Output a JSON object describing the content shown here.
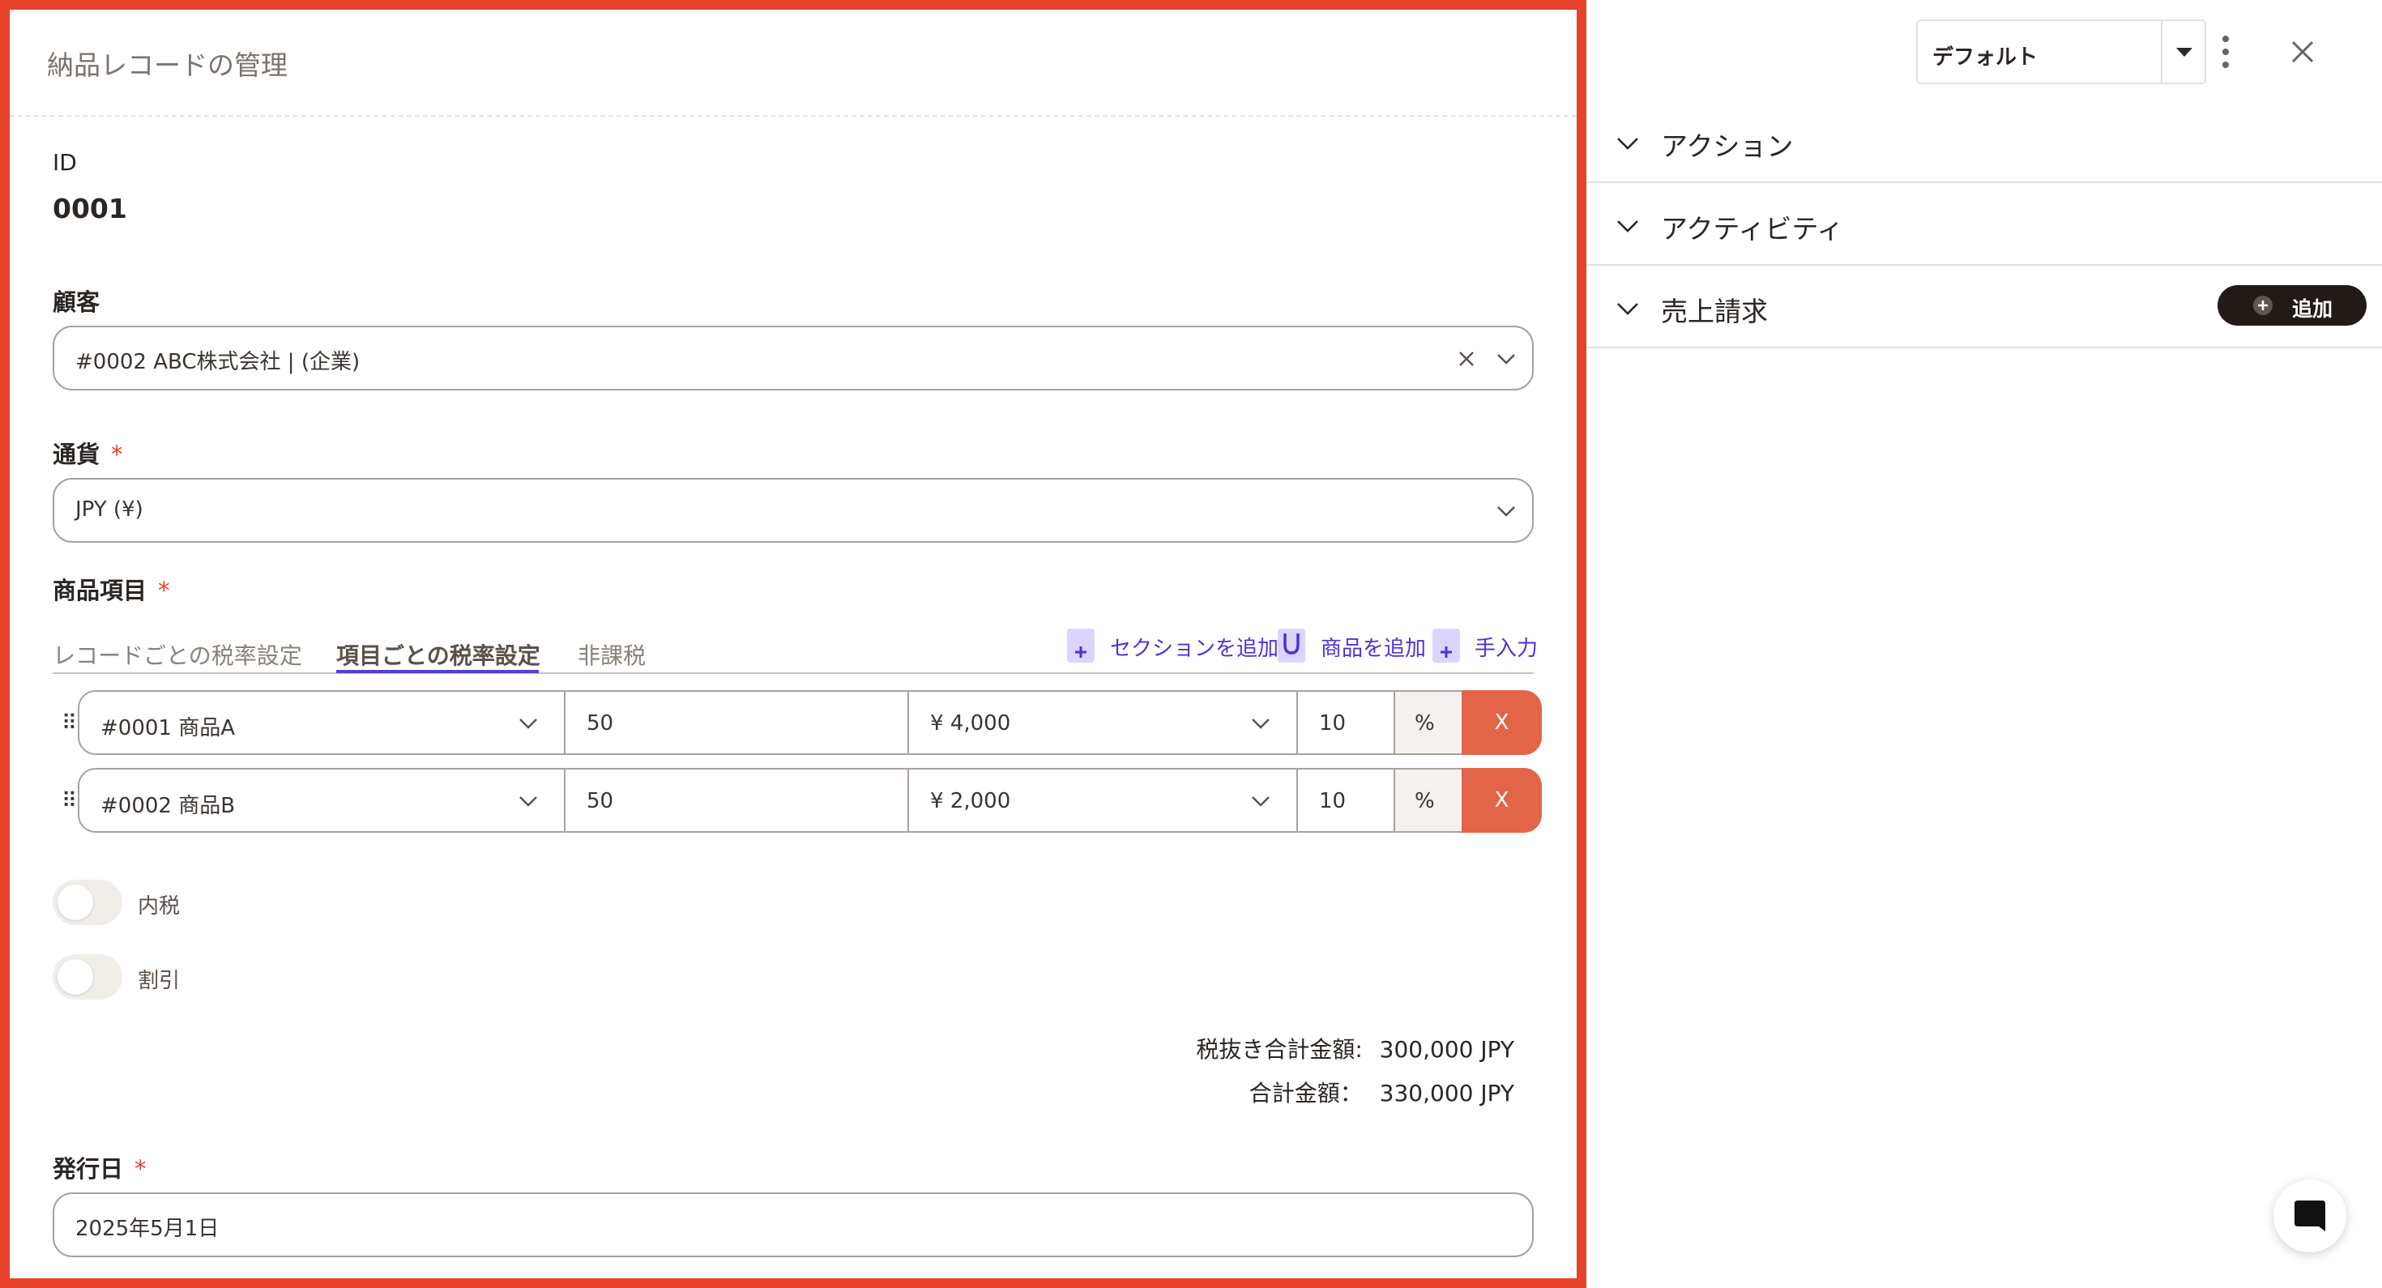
{
  "header": {
    "title": "納品レコードの管理"
  },
  "record": {
    "id_label": "ID",
    "id_value": "0001"
  },
  "customer": {
    "label": "顧客",
    "value": "#0002 ABC株式会社 | (企業)"
  },
  "currency": {
    "label": "通貨",
    "required_mark": "*",
    "value": "JPY (¥)"
  },
  "items": {
    "label": "商品項目",
    "required_mark": "*",
    "tabs": [
      {
        "label": "レコードごとの税率設定",
        "active": false
      },
      {
        "label": "項目ごとの税率設定",
        "active": true
      },
      {
        "label": "非課税",
        "active": false
      }
    ],
    "actions": {
      "add_section": "セクションを追加",
      "add_product": "商品を追加",
      "manual_entry": "手入力"
    },
    "rows": [
      {
        "handle": "⠿",
        "product": "#0001 商品A",
        "quantity": "50",
        "price": "¥ 4,000",
        "tax": "10",
        "unit": "%",
        "delete": "X"
      },
      {
        "handle": "⠿",
        "product": "#0002 商品B",
        "quantity": "50",
        "price": "¥ 2,000",
        "tax": "10",
        "unit": "%",
        "delete": "X"
      }
    ]
  },
  "toggles": {
    "tax_included": {
      "label": "内税",
      "on": false
    },
    "discount": {
      "label": "割引",
      "on": false
    }
  },
  "totals": {
    "subtotal_label": "税抜き合計金額:",
    "subtotal_value": "300,000 JPY",
    "total_label": "合計金額：",
    "total_value": "330,000 JPY"
  },
  "issue_date": {
    "label": "発行日",
    "required_mark": "*",
    "value": "2025年5月1日"
  },
  "right_panel": {
    "layout_select": "デフォルト",
    "sections": [
      {
        "label": "アクション"
      },
      {
        "label": "アクティビティ"
      },
      {
        "label": "売上請求"
      }
    ],
    "add_button": "追加"
  },
  "icons": {
    "clear": "close-icon",
    "dropdown": "chevron-down-icon",
    "more": "more-vertical-icon",
    "close_panel": "close-icon",
    "chat": "chat-icon",
    "add": "plus-circle-icon"
  },
  "colors": {
    "accent_red": "#e5432b",
    "delete_button": "#e2654a",
    "link_purple": "#4b33d6",
    "dark_button": "#211a17"
  }
}
